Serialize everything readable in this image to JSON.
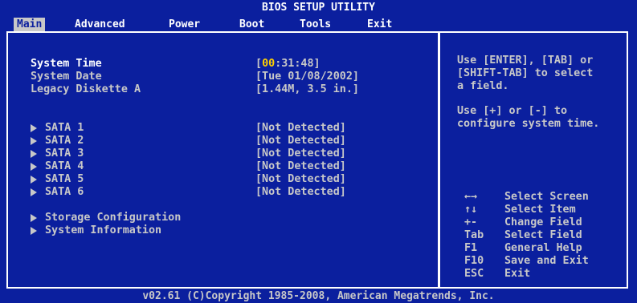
{
  "title": "BIOS SETUP UTILITY",
  "menu": {
    "main": "Main",
    "advanced": "Advanced",
    "power": "Power",
    "boot": "Boot",
    "tools": "Tools",
    "exit": "Exit"
  },
  "settings": {
    "system_time": {
      "label": "System Time",
      "value_bracket_open": "[",
      "value_highlight": "00",
      "value_rest": ":31:48]"
    },
    "system_date": {
      "label": "System Date",
      "value": "[Tue 01/08/2002]"
    },
    "legacy_diskette": {
      "label": "Legacy Diskette A",
      "value": "[1.44M, 3.5 in.]"
    }
  },
  "sata": [
    {
      "label": "SATA 1",
      "value": "[Not Detected]"
    },
    {
      "label": "SATA 2",
      "value": "[Not Detected]"
    },
    {
      "label": "SATA 3",
      "value": "[Not Detected]"
    },
    {
      "label": "SATA 4",
      "value": "[Not Detected]"
    },
    {
      "label": "SATA 5",
      "value": "[Not Detected]"
    },
    {
      "label": "SATA 6",
      "value": "[Not Detected]"
    }
  ],
  "submenus": {
    "storage": "Storage Configuration",
    "sysinfo": "System Information"
  },
  "help": {
    "line1": "Use [ENTER], [TAB] or",
    "line2": "[SHIFT-TAB] to select",
    "line3": "a field.",
    "line4": "Use [+] or [-] to",
    "line5": "configure system time."
  },
  "keys": [
    {
      "key": "←→",
      "desc": "Select Screen"
    },
    {
      "key": "↑↓",
      "desc": "Select Item"
    },
    {
      "key": "+-",
      "desc": "Change Field"
    },
    {
      "key": "Tab",
      "desc": "Select Field"
    },
    {
      "key": "F1",
      "desc": "General Help"
    },
    {
      "key": "F10",
      "desc": "Save and Exit"
    },
    {
      "key": "ESC",
      "desc": "Exit"
    }
  ],
  "footer": "v02.61 (C)Copyright 1985-2008, American Megatrends, Inc.",
  "colors": {
    "background": "#0b1f9e",
    "text": "#c8c8c8",
    "highlight": "#ffffff",
    "selected_field": "#ffd000"
  }
}
